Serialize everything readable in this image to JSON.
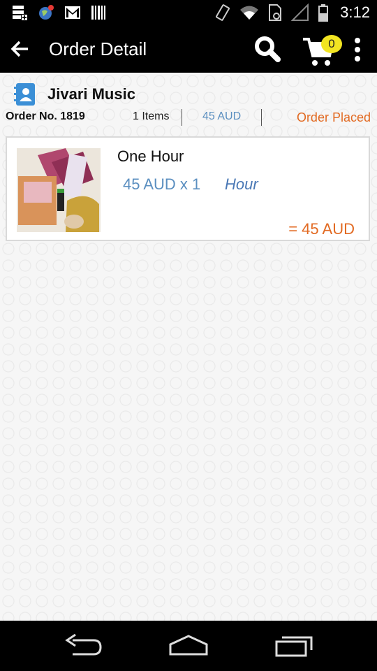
{
  "status_bar": {
    "time": "3:12",
    "icons": [
      "storage-icon",
      "globe-icon",
      "gmail-icon",
      "barcode-icon",
      "vibrate-icon",
      "wifi-icon",
      "sim-icon",
      "signal-icon",
      "battery-icon"
    ]
  },
  "action_bar": {
    "title": "Order Detail",
    "cart_count": "0"
  },
  "order": {
    "shop_name": "Jivari Music",
    "order_no": "Order No. 1819",
    "items": "1 Items",
    "total": "45 AUD",
    "status": "Order Placed"
  },
  "line_items": [
    {
      "name": "One Hour",
      "price_qty": "45 AUD x 1",
      "unit": "Hour",
      "subtotal": "= 45 AUD"
    }
  ],
  "colors": {
    "accent_blue": "#5b8fc0",
    "status_orange": "#e26a22",
    "cart_badge": "#f2e522"
  }
}
